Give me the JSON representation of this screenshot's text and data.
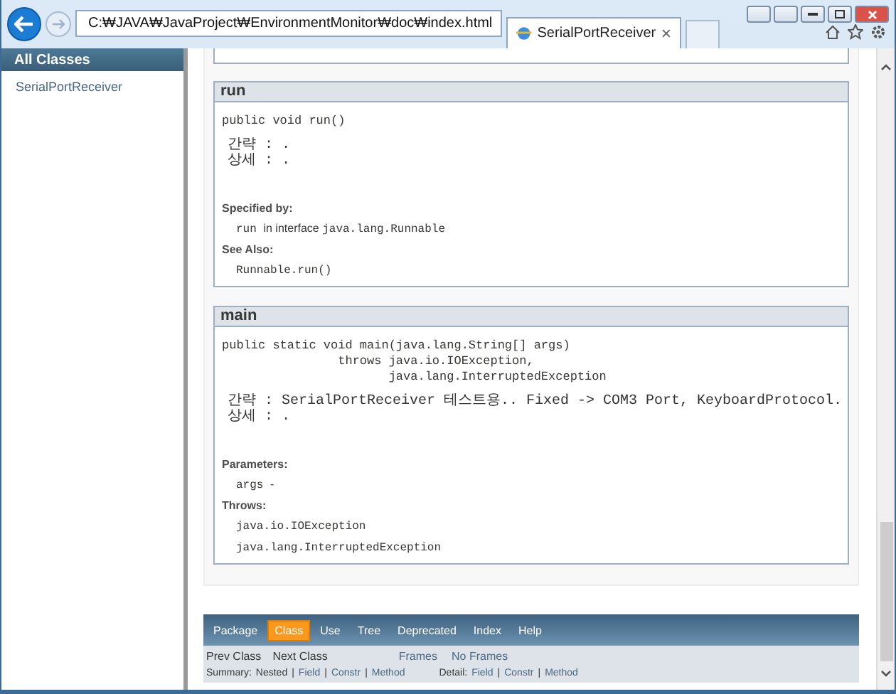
{
  "browser": {
    "address": "C:₩JAVA₩JavaProject₩EnvironmentMonitor₩doc₩index.html",
    "forward_disabled": true,
    "tab": {
      "title": "SerialPortReceiver",
      "selected": true
    }
  },
  "class_list": {
    "heading": "All Classes",
    "items": [
      "SerialPortReceiver"
    ]
  },
  "methods": [
    {
      "name": "run",
      "signature": [
        "public void run()"
      ],
      "description": [
        "간략 : .",
        "상세 : ."
      ],
      "sections": [
        {
          "heading": "Specified by:",
          "entries": [
            [
              {
                "text": "run",
                "kind": "code"
              },
              {
                "text": "in interface",
                "kind": "text"
              },
              {
                "text": "java.lang.Runnable",
                "kind": "code"
              }
            ]
          ]
        },
        {
          "heading": "See Also:",
          "entries": [
            [
              {
                "text": "Runnable.run()",
                "kind": "code"
              }
            ]
          ]
        }
      ]
    },
    {
      "name": "main",
      "signature": [
        "public static void main(java.lang.String[] args)",
        "                throws java.io.IOException,",
        "                       java.lang.InterruptedException"
      ],
      "description": [
        "간략 : SerialPortReceiver 테스트용.. Fixed -> COM3 Port, KeyboardProtocol.",
        "상세 : ."
      ],
      "sections": [
        {
          "heading": "Parameters:",
          "entries": [
            [
              {
                "text": "args",
                "kind": "code"
              },
              {
                "text": "-",
                "kind": "text"
              }
            ]
          ]
        },
        {
          "heading": "Throws:",
          "entries": [
            [
              {
                "text": "java.io.IOException",
                "kind": "code"
              }
            ],
            [
              {
                "text": "java.lang.InterruptedException",
                "kind": "code"
              }
            ]
          ]
        }
      ]
    }
  ],
  "navbar": [
    {
      "label": "Package",
      "selected": false
    },
    {
      "label": "Class",
      "selected": true
    },
    {
      "label": "Use",
      "selected": false
    },
    {
      "label": "Tree",
      "selected": false
    },
    {
      "label": "Deprecated",
      "selected": false
    },
    {
      "label": "Index",
      "selected": false
    },
    {
      "label": "Help",
      "selected": false
    }
  ],
  "subnav": {
    "prev_next": [
      {
        "text": "Prev Class",
        "link": false
      },
      {
        "text": "Next Class",
        "link": false
      }
    ],
    "frames": [
      {
        "text": "Frames",
        "link": true
      },
      {
        "text": "No Frames",
        "link": true
      }
    ],
    "summary": [
      {
        "text": "Summary:",
        "link": false
      },
      {
        "text": "Nested",
        "link": false
      },
      {
        "text": "|",
        "link": false
      },
      {
        "text": "Field",
        "link": true
      },
      {
        "text": "|",
        "link": false
      },
      {
        "text": "Constr",
        "link": true
      },
      {
        "text": "|",
        "link": false
      },
      {
        "text": "Method",
        "link": true
      }
    ],
    "detail": [
      {
        "text": "Detail:",
        "link": false
      },
      {
        "text": "Field",
        "link": true
      },
      {
        "text": "|",
        "link": false
      },
      {
        "text": "Constr",
        "link": true
      },
      {
        "text": "|",
        "link": false
      },
      {
        "text": "Method",
        "link": true
      }
    ]
  }
}
